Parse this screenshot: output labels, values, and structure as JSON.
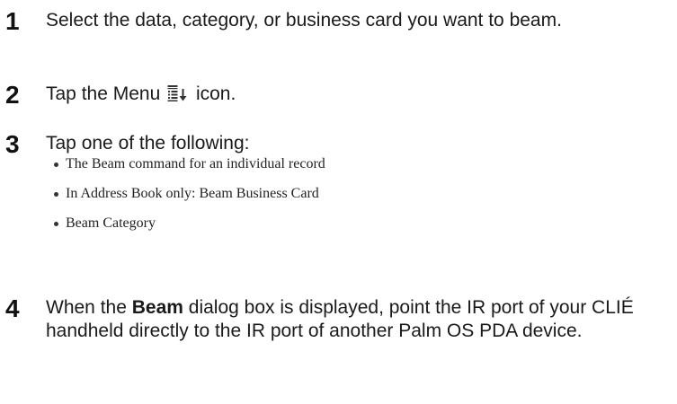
{
  "steps": [
    {
      "number": "1",
      "text": "Select the data, category, or business card you want to beam."
    },
    {
      "number": "2",
      "text_before": "Tap the Menu",
      "icon": "menu-icon",
      "text_after": "icon."
    },
    {
      "number": "3",
      "text": "Tap one of the following:",
      "bullets": [
        "The Beam command for an individual record",
        "In Address Book only: Beam Business Card",
        "Beam Category"
      ]
    },
    {
      "number": "4",
      "text_before": "When the",
      "bold": "Beam",
      "text_after": "dialog box is displayed, point the IR port of your CLIÉ handheld directly to the IR port of another Palm OS PDA device."
    }
  ]
}
